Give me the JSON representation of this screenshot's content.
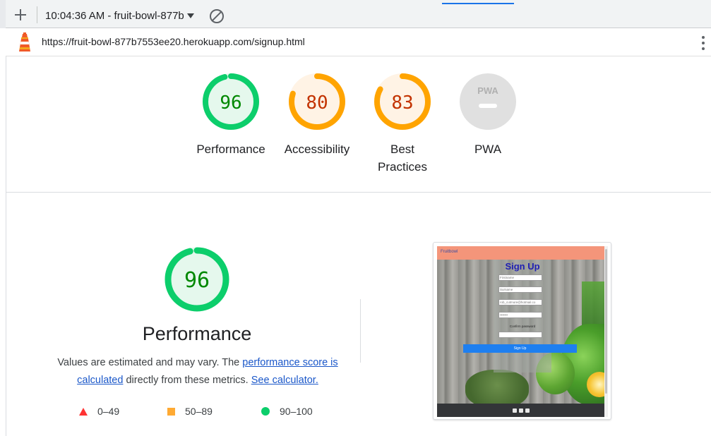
{
  "toolbar": {
    "new_report_label": "+",
    "report_selector": "10:04:36 AM - fruit-bowl-877b",
    "clear_label": "Clear"
  },
  "urlbar": {
    "url": "https://fruit-bowl-877b7553ee20.herokuapp.com/signup.html"
  },
  "colors": {
    "pass": "#0cce6b",
    "pass_text": "#008800",
    "pass_fill": "#e5f8ed",
    "average": "#ffa400",
    "average_text": "#c33300",
    "average_fill": "#fff3e5",
    "fail": "#ff3333",
    "na_fill": "#e0e0e0",
    "link": "#1a57c9"
  },
  "gauges": [
    {
      "id": "performance",
      "score": 96,
      "label": "Performance",
      "rating": "pass"
    },
    {
      "id": "accessibility",
      "score": 80,
      "label": "Accessibility",
      "rating": "average"
    },
    {
      "id": "best-practices",
      "score": 83,
      "label": "Best Practices",
      "rating": "average"
    },
    {
      "id": "pwa",
      "score": null,
      "label": "PWA",
      "badge": "PWA",
      "rating": "na"
    }
  ],
  "performance": {
    "score": 96,
    "title": "Performance",
    "desc_prefix": "Values are estimated and may vary. The ",
    "link1": "performance score is calculated",
    "desc_middle": " directly from these metrics. ",
    "link2": "See calculator."
  },
  "legend": {
    "fail": "0–49",
    "average": "50–89",
    "pass": "90–100"
  },
  "screenshot": {
    "brand": "Fruitbowl",
    "heading": "Sign Up",
    "firstname_placeholder": "Firstname",
    "surname_placeholder": "Surname",
    "email_value": "rob_cutmore@hotmail.co",
    "password_value": "•••••••",
    "confirm_label": "Confirm password",
    "button": "Sign Up",
    "social_icons": [
      "facebook-icon",
      "twitter-icon",
      "instagram-icon"
    ]
  }
}
